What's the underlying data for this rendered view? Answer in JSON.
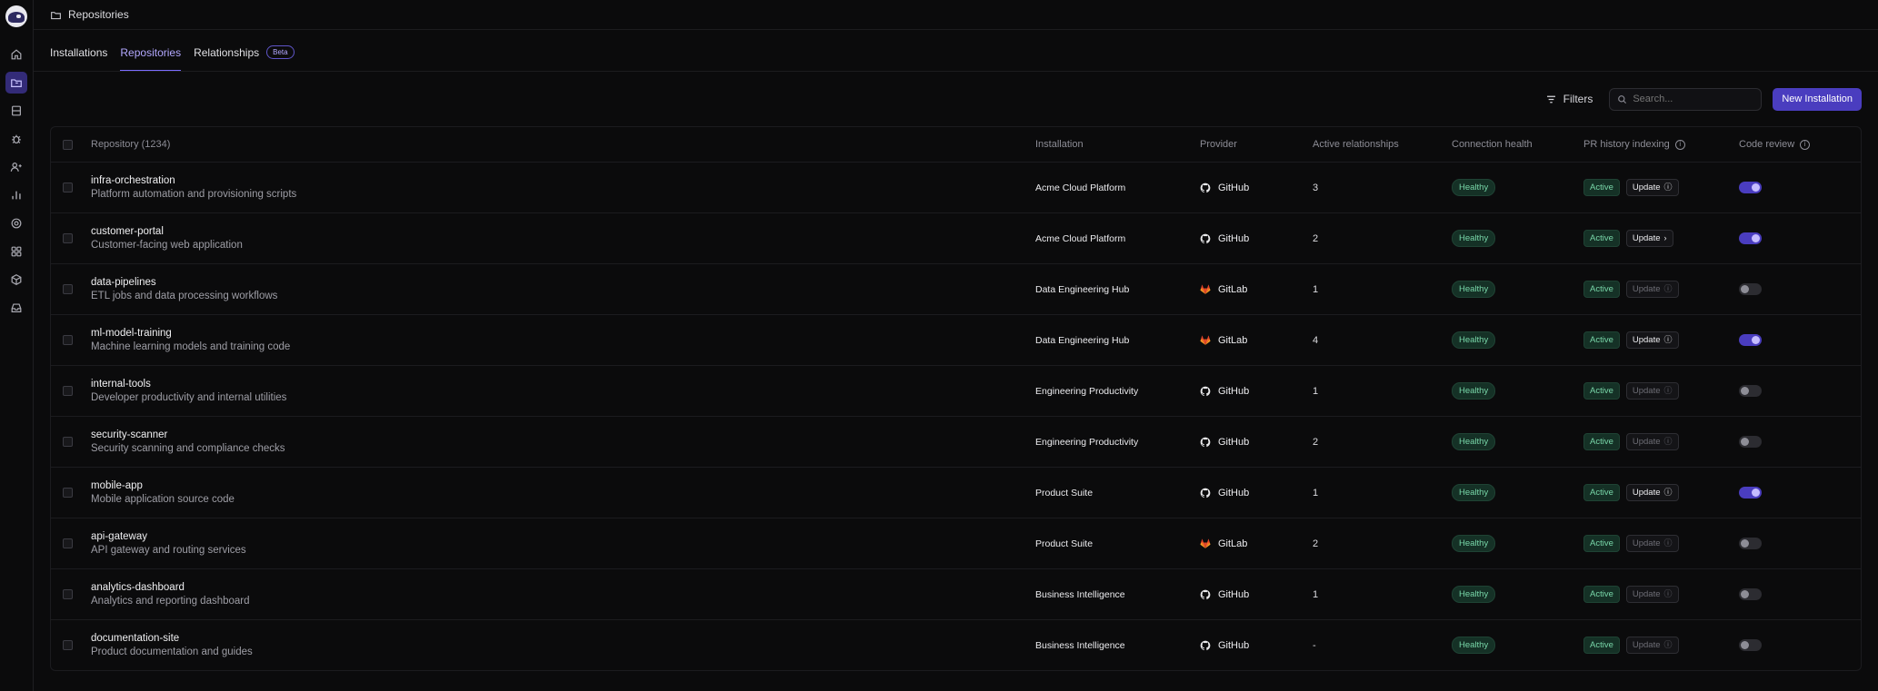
{
  "breadcrumb": {
    "title": "Repositories"
  },
  "tabs": [
    {
      "label": "Installations"
    },
    {
      "label": "Repositories"
    },
    {
      "label": "Relationships",
      "badge": "Beta"
    }
  ],
  "toolbar": {
    "filters_label": "Filters",
    "search_placeholder": "Search...",
    "new_installation_label": "New Installation"
  },
  "table": {
    "headers": {
      "repository": "Repository (1234)",
      "installation": "Installation",
      "provider": "Provider",
      "active_relationships": "Active relationships",
      "connection_health": "Connection health",
      "pr_history": "PR history indexing",
      "code_review": "Code review"
    },
    "rows": [
      {
        "name": "infra-orchestration",
        "description": "Platform automation and provisioning scripts",
        "installation": "Acme Cloud Platform",
        "provider": "GitHub",
        "relationships": "3",
        "health": "Healthy",
        "pr_status": "Active",
        "update_label": "Update",
        "code_review": true
      },
      {
        "name": "customer-portal",
        "description": "Customer-facing web application",
        "installation": "Acme Cloud Platform",
        "provider": "GitHub",
        "relationships": "2",
        "health": "Healthy",
        "pr_status": "Active",
        "update_label": "Update",
        "code_review": true
      },
      {
        "name": "data-pipelines",
        "description": "ETL jobs and data processing workflows",
        "installation": "Data Engineering Hub",
        "provider": "GitLab",
        "relationships": "1",
        "health": "Healthy",
        "pr_status": "Active",
        "update_label": "Update",
        "code_review": false
      },
      {
        "name": "ml-model-training",
        "description": "Machine learning models and training code",
        "installation": "Data Engineering Hub",
        "provider": "GitLab",
        "relationships": "4",
        "health": "Healthy",
        "pr_status": "Active",
        "update_label": "Update",
        "code_review": true
      },
      {
        "name": "internal-tools",
        "description": "Developer productivity and internal utilities",
        "installation": "Engineering Productivity",
        "provider": "GitHub",
        "relationships": "1",
        "health": "Healthy",
        "pr_status": "Active",
        "update_label": "Update",
        "code_review": false
      },
      {
        "name": "security-scanner",
        "description": "Security scanning and compliance checks",
        "installation": "Engineering Productivity",
        "provider": "GitHub",
        "relationships": "2",
        "health": "Healthy",
        "pr_status": "Active",
        "update_label": "Update",
        "code_review": false
      },
      {
        "name": "mobile-app",
        "description": "Mobile application source code",
        "installation": "Product Suite",
        "provider": "GitHub",
        "relationships": "1",
        "health": "Healthy",
        "pr_status": "Active",
        "update_label": "Update",
        "code_review": true
      },
      {
        "name": "api-gateway",
        "description": "API gateway and routing services",
        "installation": "Product Suite",
        "provider": "GitLab",
        "relationships": "2",
        "health": "Healthy",
        "pr_status": "Active",
        "update_label": "Update",
        "code_review": false
      },
      {
        "name": "analytics-dashboard",
        "description": "Analytics and reporting dashboard",
        "installation": "Business Intelligence",
        "provider": "GitHub",
        "relationships": "1",
        "health": "Healthy",
        "pr_status": "Active",
        "update_label": "Update",
        "code_review": false
      },
      {
        "name": "documentation-site",
        "description": "Product documentation and guides",
        "installation": "Business Intelligence",
        "provider": "GitHub",
        "relationships": "-",
        "health": "Healthy",
        "pr_status": "Active",
        "update_label": "Update",
        "code_review": false
      }
    ]
  },
  "colors": {
    "accent": "#4a3dbf",
    "healthy": "#78d6a8",
    "background": "#0b0b0c"
  }
}
